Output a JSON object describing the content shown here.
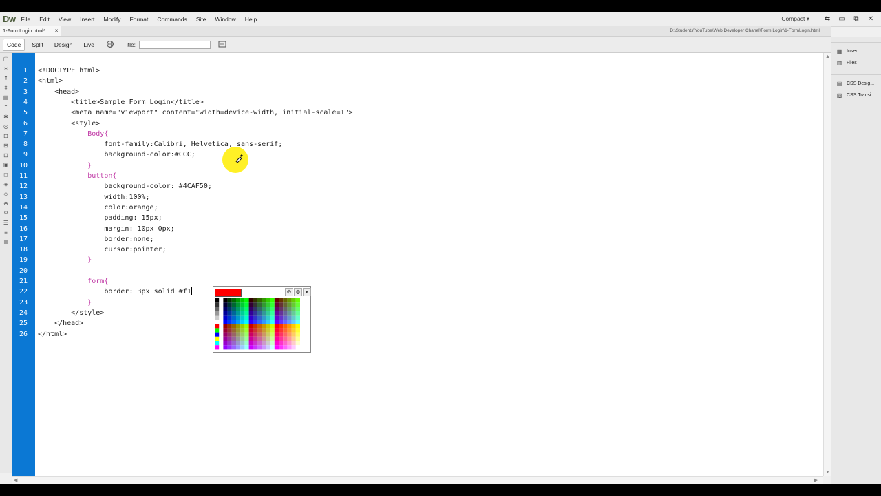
{
  "app": {
    "logo": "Dw",
    "menu": [
      "File",
      "Edit",
      "View",
      "Insert",
      "Modify",
      "Format",
      "Commands",
      "Site",
      "Window",
      "Help"
    ],
    "workspace": "Compact ▾",
    "window_icons": {
      "sync": "⇆",
      "minimize": "▭",
      "maximize": "⧉",
      "close": "✕",
      "help": "ⓘ"
    }
  },
  "tab": {
    "filename": "1-FormLogin.html*",
    "close": "×",
    "path": "D:\\Students\\YouTube\\Web Developer Chanel\\Form Login\\1-FormLogin.html"
  },
  "toolbar": {
    "code": "Code",
    "split": "Split",
    "design": "Design",
    "live": "Live",
    "title_label": "Title:",
    "title_value": ""
  },
  "editor": {
    "line_numbers": [
      "1",
      "2",
      "3",
      "4",
      "5",
      "6",
      "7",
      "8",
      "9",
      "10",
      "11",
      "12",
      "13",
      "14",
      "15",
      "16",
      "17",
      "18",
      "19",
      "20",
      "21",
      "22",
      "23",
      "24",
      "25",
      "26"
    ],
    "lines": [
      "<!DOCTYPE html>",
      "<html>",
      "    <head>",
      "        <title>Sample Form Login</title>",
      "        <meta name=\"viewport\" content=\"width=device-width, initial-scale=1\">",
      "        <style>",
      "            Body{",
      "                font-family:Calibri, Helvetica, sans-serif;",
      "                background-color:#CCC;",
      "            }",
      "            button{",
      "                background-color: #4CAF50;",
      "                width:100%;",
      "                color:orange;",
      "                padding: 15px;",
      "                margin: 10px 0px;",
      "                border:none;",
      "                cursor:pointer;",
      "            }",
      "",
      "            form{",
      "                border: 3px solid #f1",
      "            }",
      "        </style>",
      "    </head>",
      "</html>"
    ]
  },
  "color_picker": {
    "current": "#ff0000",
    "default_icon": "⊘",
    "system_icon": "◍",
    "menu_icon": "▸"
  },
  "right_panel": {
    "items": [
      {
        "label": "Insert",
        "icon": "insert-icon"
      },
      {
        "label": "Files",
        "icon": "files-icon"
      },
      {
        "label": "CSS Desig...",
        "icon": "css-designer-icon"
      },
      {
        "label": "CSS Transi...",
        "icon": "css-transitions-icon"
      }
    ]
  }
}
